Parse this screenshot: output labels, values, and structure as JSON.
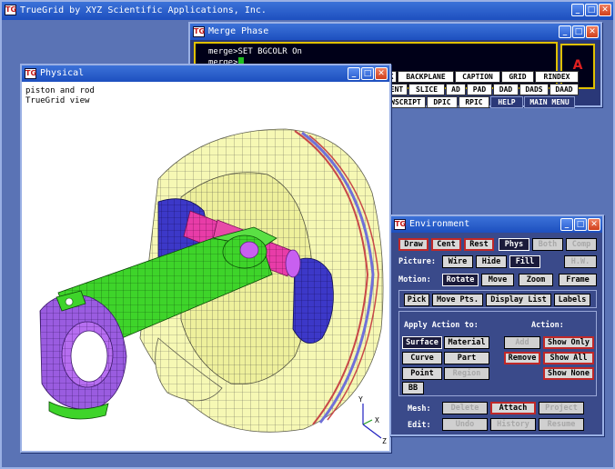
{
  "app": {
    "title": "TrueGrid by XYZ Scientific Applications, Inc."
  },
  "logo_text": "TG",
  "window_buttons": {
    "minimize": "_",
    "maximize": "□",
    "close": "✕"
  },
  "merge": {
    "title": "Merge Phase",
    "console_lines": [
      "merge>SET BGCOLR On",
      "merge>"
    ],
    "alert": "A",
    "buttons_row1": [
      "K",
      "BACKPLANE",
      "CAPTION",
      "GRID",
      "RINDEX"
    ],
    "buttons_row2": [
      "ENT",
      "SLICE",
      "AD",
      "PAD",
      "DAD",
      "DADS",
      "DAAD"
    ],
    "buttons_row3": [
      "WSCRIPT",
      "DPIC",
      "RPIC",
      "HELP",
      "MAIN MENU"
    ]
  },
  "physical": {
    "title": "Physical",
    "notes": [
      "piston and rod",
      "TrueGrid view"
    ],
    "axes": {
      "y": "Y",
      "x": "X",
      "z": "Z"
    }
  },
  "environment": {
    "title": "Environment",
    "top_row": [
      "Draw",
      "Cent",
      "Rest",
      "Phys",
      "Both",
      "Comp"
    ],
    "picture_label": "Picture:",
    "picture_options": [
      "Wire",
      "Hide",
      "Fill",
      "H.W."
    ],
    "motion_label": "Motion:",
    "motion_options": [
      "Rotate",
      "Move",
      "Zoom",
      "Frame"
    ],
    "tabs": [
      "Pick",
      "Move Pts.",
      "Display List",
      "Labels"
    ],
    "apply_label": "Apply Action to:",
    "action_label": "Action:",
    "targets": [
      "Surface",
      "Material",
      "Curve",
      "Part",
      "Point",
      "Region",
      "BB"
    ],
    "actions": [
      "Add",
      "Show Only",
      "Remove",
      "Show All",
      "Show None"
    ],
    "mesh_label": "Mesh:",
    "mesh_buttons": [
      "Delete",
      "Attach",
      "Project"
    ],
    "edit_label": "Edit:",
    "edit_buttons": [
      "Undo",
      "History",
      "Resume"
    ]
  }
}
